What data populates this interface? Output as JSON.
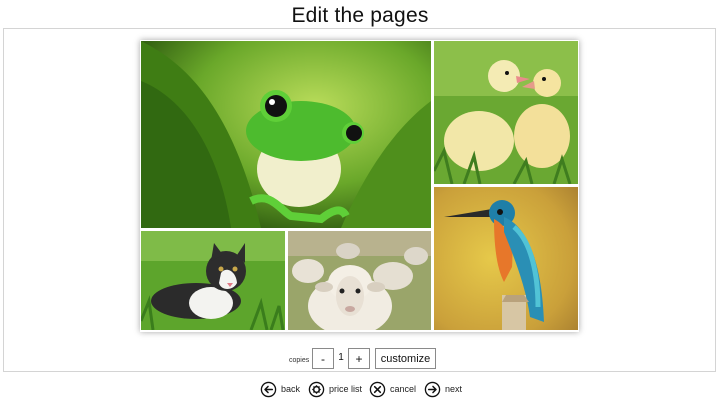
{
  "header": {
    "title": "Edit the pages"
  },
  "photos": [
    {
      "subject": "frog"
    },
    {
      "subject": "ducklings"
    },
    {
      "subject": "kingfisher"
    },
    {
      "subject": "kitten"
    },
    {
      "subject": "sheep"
    }
  ],
  "controls": {
    "copies_label": "copies",
    "minus_label": "-",
    "count": "1",
    "plus_label": "+",
    "customize_label": "customize"
  },
  "nav": {
    "back": {
      "label": "back",
      "icon": "arrow-left-circle-icon"
    },
    "price_list": {
      "label": "price list",
      "icon": "gear-circle-icon"
    },
    "cancel": {
      "label": "cancel",
      "icon": "x-circle-icon"
    },
    "next": {
      "label": "next",
      "icon": "arrow-right-circle-icon"
    }
  }
}
